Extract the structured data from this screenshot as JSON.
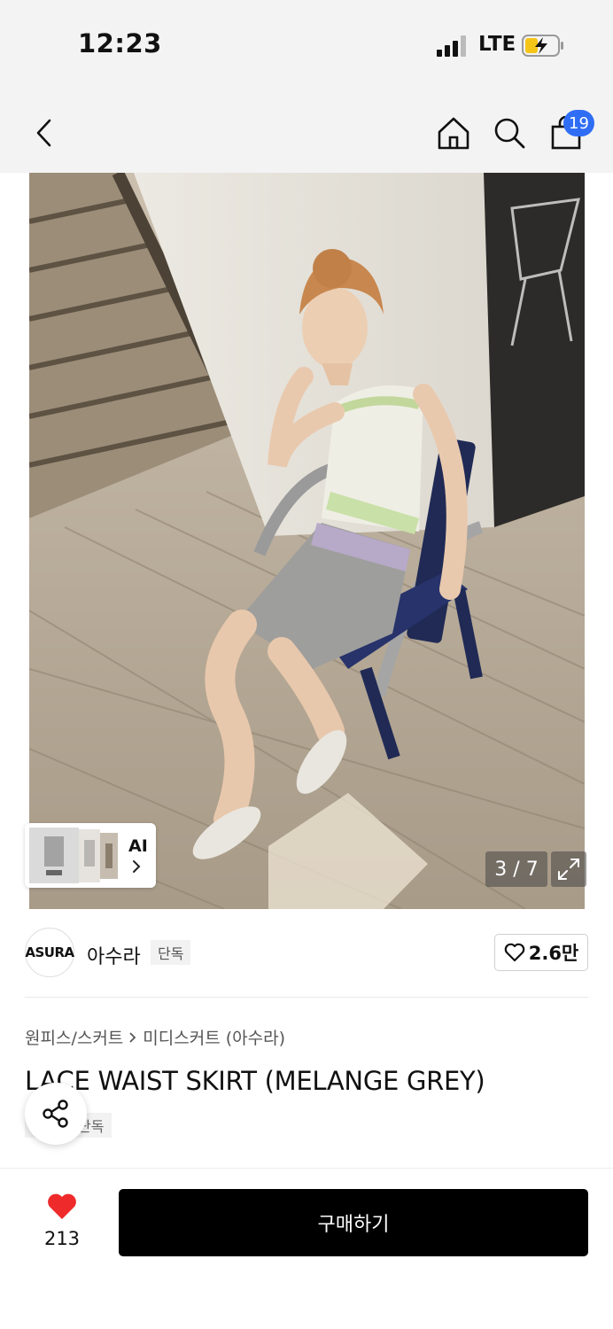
{
  "status_bar": {
    "time": "12:23",
    "network": "LTE"
  },
  "nav": {
    "cart_count": "19"
  },
  "gallery": {
    "page_indicator": "3 / 7",
    "ai_label": "AI"
  },
  "brand": {
    "logo_text": "ASURA",
    "name": "아수라",
    "exclusive_tag": "단독",
    "like_count": "2.6만"
  },
  "product": {
    "breadcrumb": {
      "category": "원피스/스커트",
      "subcategory": "미디스커트 (아수라)"
    },
    "title": "LACE WAIST SKIRT (MELANGE GREY)",
    "tag": "단독"
  },
  "bottom_bar": {
    "wish_count": "213",
    "buy_label": "구매하기"
  },
  "colors": {
    "accent": "#2f6df5",
    "heart": "#ee2a2a",
    "buy_button": "#000000"
  },
  "icons": [
    "back-arrow-icon",
    "home-icon",
    "search-icon",
    "shopping-bag-icon",
    "chevron-right-icon",
    "fullscreen-icon",
    "heart-outline-icon",
    "share-icon",
    "heart-filled-icon"
  ]
}
